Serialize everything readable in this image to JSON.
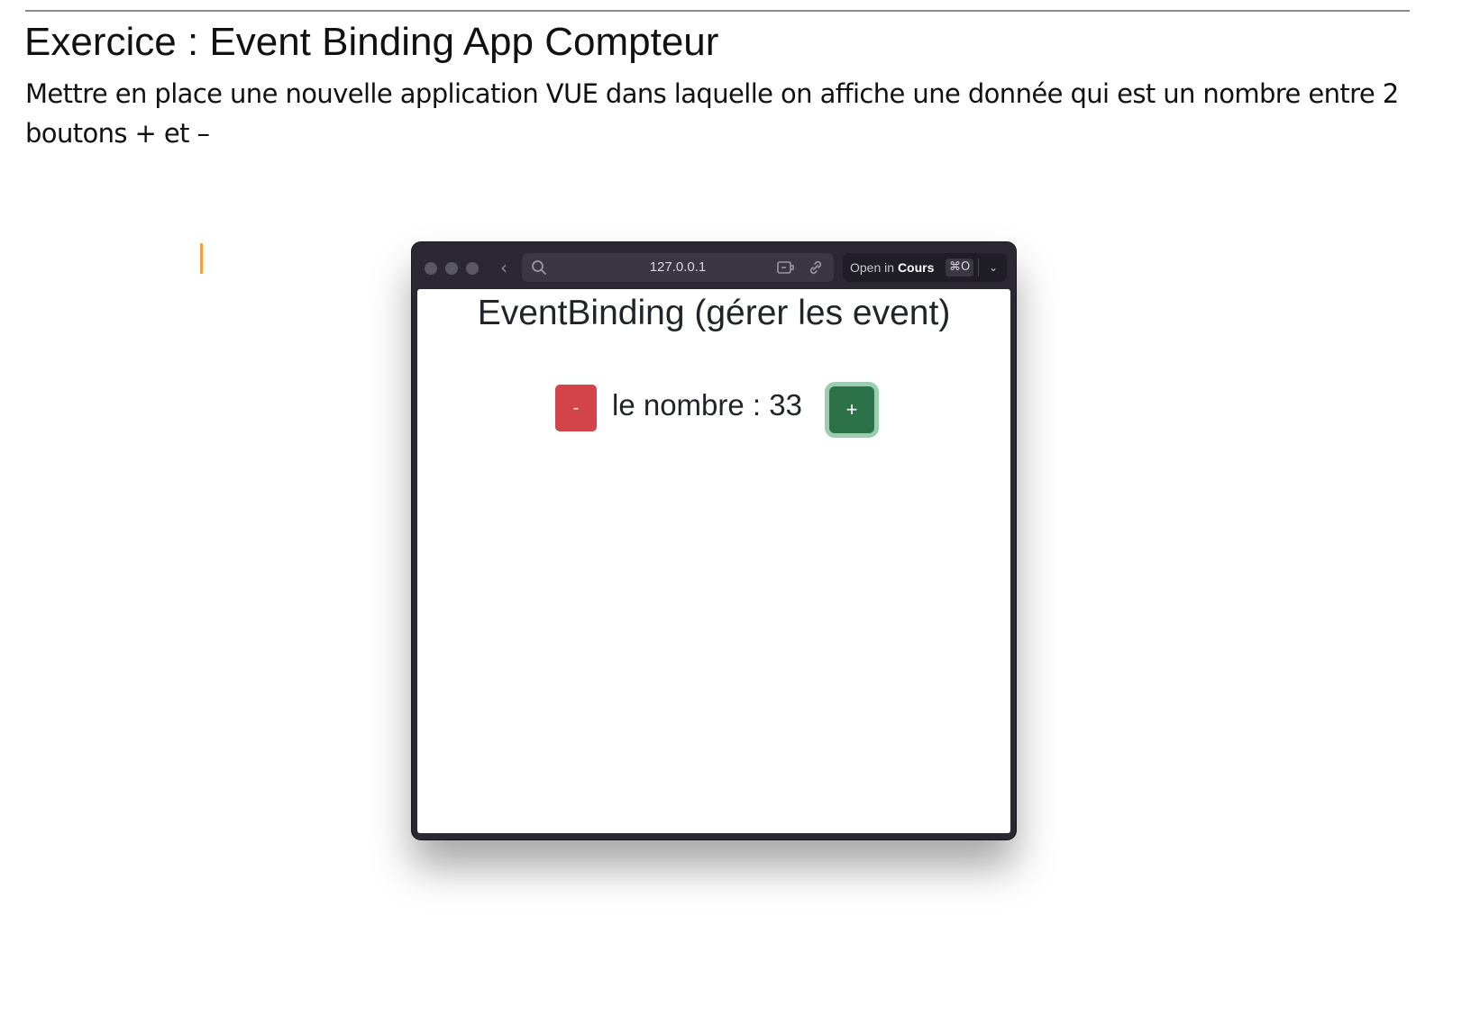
{
  "document": {
    "title": "Exercice : Event Binding App Compteur",
    "paragraph": "Mettre en place une nouvelle application VUE dans laquelle on affiche une donnée qui est un nombre entre 2 boutons + et –"
  },
  "browser": {
    "url": "127.0.0.1",
    "open_in_prefix": "Open in",
    "open_in_app": "Cours",
    "open_in_shortcut": "⌘O"
  },
  "app": {
    "title": "EventBinding (gérer les event)",
    "decrement_label": "-",
    "counter_text": "le nombre : 33",
    "increment_label": "+"
  },
  "colors": {
    "decrement_button": "#d2434a",
    "increment_button": "#2d7148",
    "increment_focus_ring": "#9ccdb1",
    "window_chrome": "#2b2833",
    "text_cursor": "#f0a23a"
  },
  "icons": [
    "back-chevron-icon",
    "search-icon",
    "extension-icon",
    "link-icon",
    "chevron-down-icon"
  ]
}
